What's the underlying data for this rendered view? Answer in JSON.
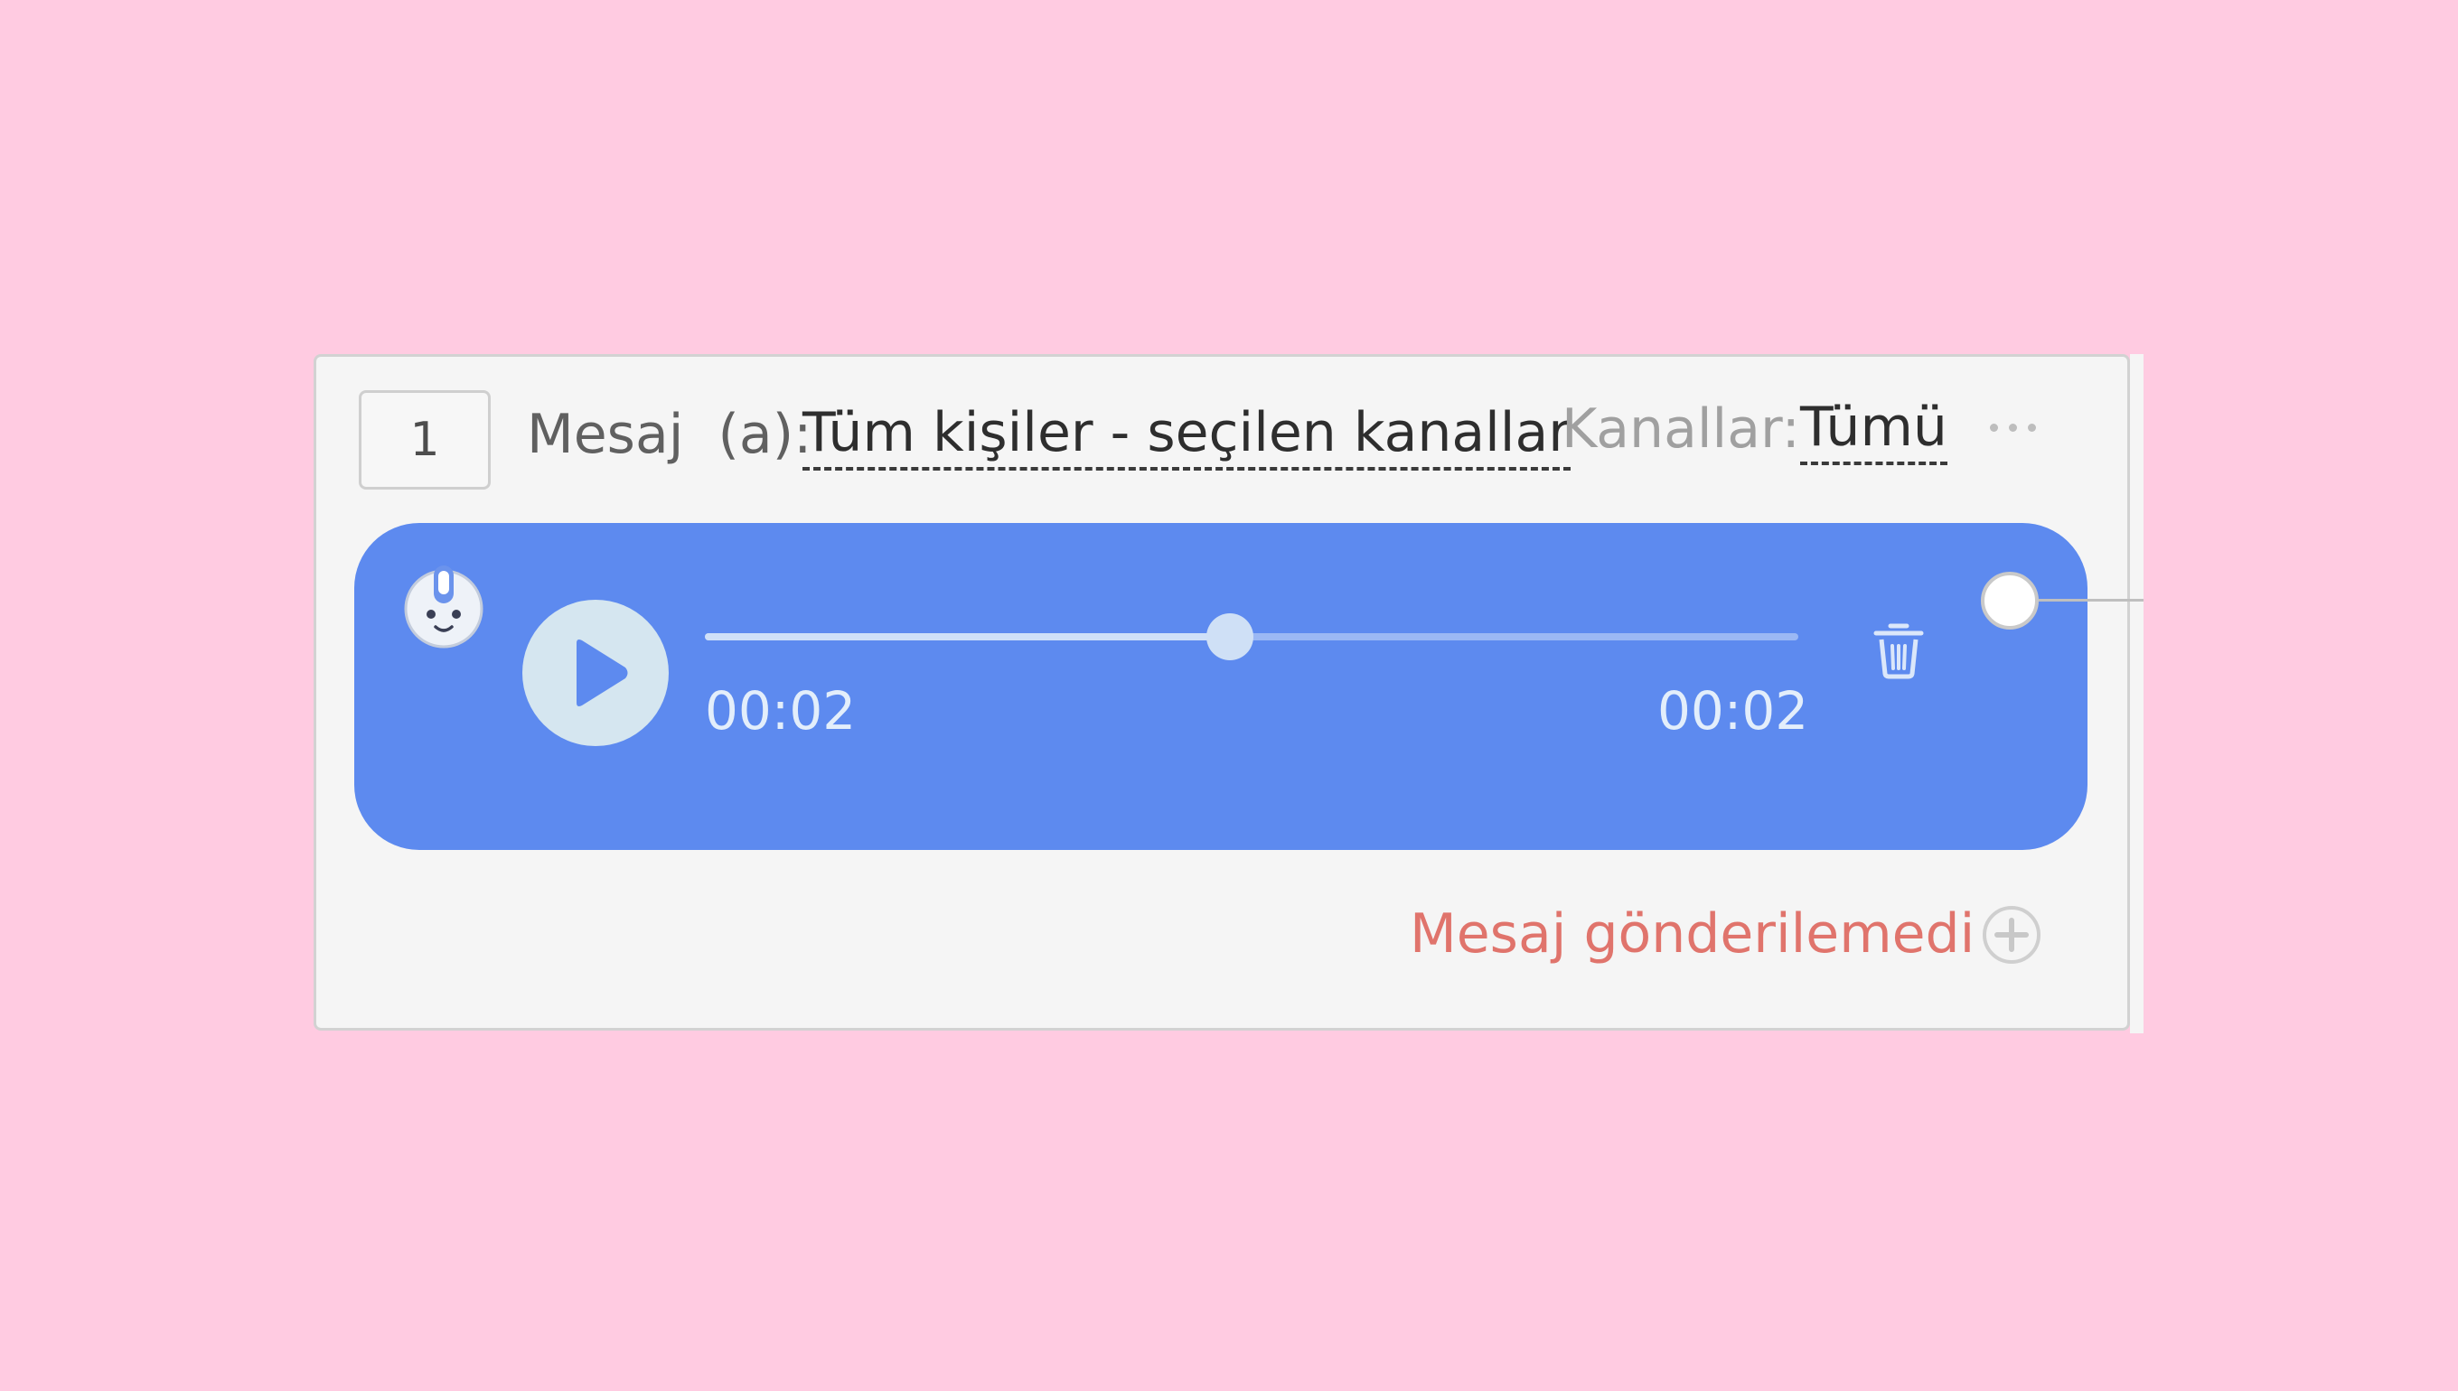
{
  "message_block": {
    "step_number": "1",
    "message_label": "Mesaj  (a):",
    "recipients_link": "Tüm kişiler - seçilen kanallar",
    "channels_label": "Kanallar:",
    "channels_value": "Tümü",
    "more_icon": "more-horizontal-icon"
  },
  "audio_message": {
    "avatar_icon": "bot-avatar-icon",
    "play_icon": "play-icon",
    "current_time": "00:02",
    "total_time": "00:02",
    "progress_fraction": 0.48,
    "delete_icon": "trash-icon"
  },
  "footer": {
    "error_text": "Mesaj gönderilemedi",
    "add_icon": "plus-circle-icon"
  },
  "colors": {
    "page_background": "#ffcbe1",
    "bubble": "#5d8aef",
    "error": "#e0746c"
  }
}
